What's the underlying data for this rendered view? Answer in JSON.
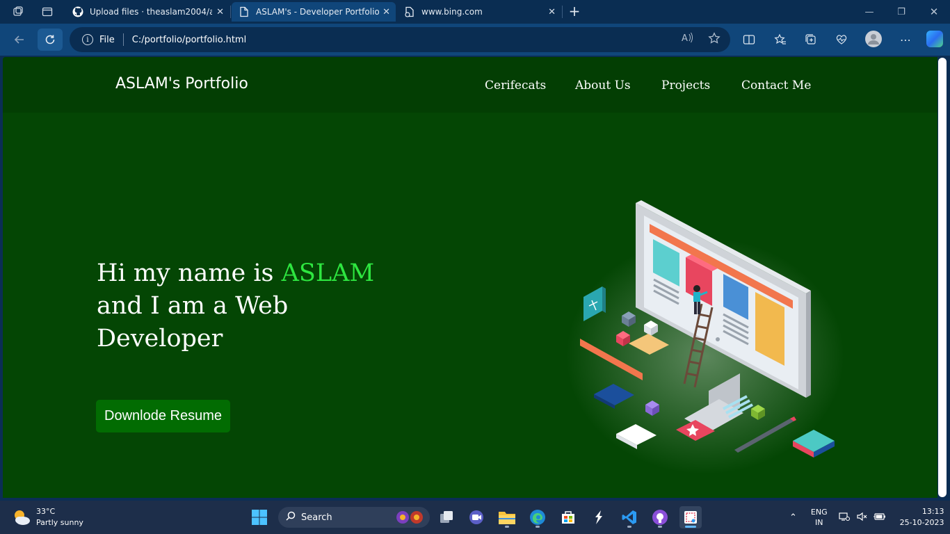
{
  "browser": {
    "tabs": [
      {
        "title": "Upload files · theaslam2004/aslam",
        "favicon": "github-icon",
        "active": false
      },
      {
        "title": "ASLAM's - Developer Portfolio",
        "favicon": "page-icon",
        "active": true
      },
      {
        "title": "www.bing.com",
        "favicon": "bing-icon",
        "active": false
      }
    ],
    "new_tab": "+",
    "address": {
      "scheme_label": "File",
      "url": "C:/portfolio/portfolio.html"
    }
  },
  "site": {
    "brand": "ASLAM's Portfolio",
    "nav": [
      "Cerifecats",
      "About Us",
      "Projects",
      "Contact Me"
    ],
    "hero": {
      "intro": "Hi my name is ",
      "name": "ASLAM",
      "rest": "and I am a Web Developer"
    },
    "cta": "Downlode Resume",
    "colors": {
      "bg": "#044604",
      "header": "#033e03",
      "accent": "#2ee640",
      "button": "#026c02"
    }
  },
  "taskbar": {
    "weather": {
      "temp": "33°C",
      "desc": "Partly sunny"
    },
    "search_label": "Search",
    "tray": {
      "lang": "ENG",
      "region": "IN",
      "time": "13:13",
      "date": "25-10-2023"
    }
  }
}
